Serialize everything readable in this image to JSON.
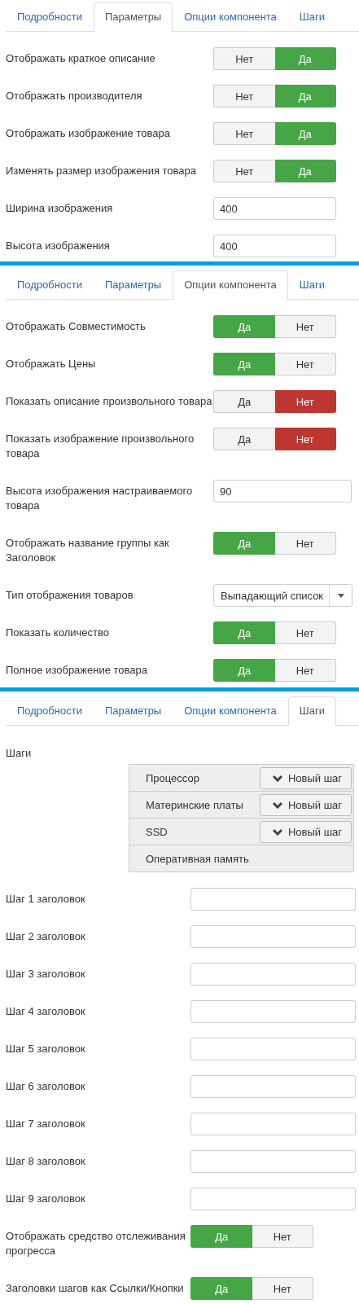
{
  "panels": [
    {
      "tabs": [
        {
          "label": "Подробности",
          "selected": false
        },
        {
          "label": "Параметры",
          "selected": true
        },
        {
          "label": "Опции компонента",
          "selected": false
        },
        {
          "label": "Шаги",
          "selected": false
        }
      ],
      "fields": [
        {
          "kind": "toggle",
          "label": "Отображать краткое описание",
          "color": "#46a546",
          "options": [
            {
              "label": "Нет",
              "selected": false
            },
            {
              "label": "Да",
              "selected": true
            }
          ]
        },
        {
          "kind": "toggle",
          "label": "Отображать производителя",
          "color": "#46a546",
          "options": [
            {
              "label": "Нет",
              "selected": false
            },
            {
              "label": "Да",
              "selected": true
            }
          ]
        },
        {
          "kind": "toggle",
          "label": "Отображать изображение товара",
          "color": "#46a546",
          "options": [
            {
              "label": "Нет",
              "selected": false
            },
            {
              "label": "Да",
              "selected": true
            }
          ]
        },
        {
          "kind": "toggle",
          "label": "Изменять размер изображения товара",
          "color": "#46a546",
          "options": [
            {
              "label": "Нет",
              "selected": false
            },
            {
              "label": "Да",
              "selected": true
            }
          ]
        },
        {
          "kind": "text",
          "label": "Ширина изображения",
          "value": "400"
        },
        {
          "kind": "text",
          "label": "Высота изображения",
          "value": "400"
        }
      ]
    },
    {
      "tabs": [
        {
          "label": "Подробности",
          "selected": false
        },
        {
          "label": "Параметры",
          "selected": false
        },
        {
          "label": "Опции компонента",
          "selected": true
        },
        {
          "label": "Шаги",
          "selected": false
        }
      ],
      "fields": [
        {
          "kind": "toggle",
          "label": "Отображать Совместимость",
          "color": "#46a546",
          "options": [
            {
              "label": "Да",
              "selected": true
            },
            {
              "label": "Нет",
              "selected": false
            }
          ]
        },
        {
          "kind": "toggle",
          "label": "Отображать Цены",
          "color": "#46a546",
          "options": [
            {
              "label": "Да",
              "selected": true
            },
            {
              "label": "Нет",
              "selected": false
            }
          ]
        },
        {
          "kind": "toggle",
          "label": "Показать описание произвольного товара",
          "color": "#bd362f",
          "options": [
            {
              "label": "Да",
              "selected": false
            },
            {
              "label": "Нет",
              "selected": true
            }
          ]
        },
        {
          "kind": "toggle",
          "label": "Показать изображение произвольного товара",
          "color": "#bd362f",
          "options": [
            {
              "label": "Да",
              "selected": false
            },
            {
              "label": "Нет",
              "selected": true
            }
          ]
        },
        {
          "kind": "text",
          "label": "Высота изображения настраиваемого товара",
          "value": "90"
        },
        {
          "kind": "toggle",
          "label": "Отображать название группы как Заголовок",
          "color": "#46a546",
          "options": [
            {
              "label": "Да",
              "selected": true
            },
            {
              "label": "Нет",
              "selected": false
            }
          ]
        },
        {
          "kind": "select",
          "label": "Тип отображения товаров",
          "value": "Выпадающий список"
        },
        {
          "kind": "toggle",
          "label": "Показать количество",
          "color": "#46a546",
          "options": [
            {
              "label": "Да",
              "selected": true
            },
            {
              "label": "Нет",
              "selected": false
            }
          ]
        },
        {
          "kind": "toggle",
          "label": "Полное изображение товара",
          "color": "#46a546",
          "options": [
            {
              "label": "Да",
              "selected": true
            },
            {
              "label": "Нет",
              "selected": false
            }
          ]
        }
      ]
    },
    {
      "tabs": [
        {
          "label": "Подробности",
          "selected": false
        },
        {
          "label": "Параметры",
          "selected": false
        },
        {
          "label": "Опции компонента",
          "selected": false
        },
        {
          "label": "Шаги",
          "selected": true
        }
      ],
      "steps": {
        "label": "Шаги",
        "items": [
          {
            "name": "Процессор",
            "button": "Новый шаг"
          },
          {
            "name": "Материнские платы",
            "button": "Новый шаг"
          },
          {
            "name": "SSD",
            "button": "Новый шаг"
          },
          {
            "name": "Оперативная память"
          }
        ]
      },
      "fields": [
        {
          "kind": "text",
          "label": "Шаг 1 заголовок"
        },
        {
          "kind": "text",
          "label": "Шаг 2 заголовок"
        },
        {
          "kind": "text",
          "label": "Шаг 3 заголовок"
        },
        {
          "kind": "text",
          "label": "Шаг 4 заголовок"
        },
        {
          "kind": "text",
          "label": "Шаг 5 заголовок"
        },
        {
          "kind": "text",
          "label": "Шаг 6 заголовок"
        },
        {
          "kind": "text",
          "label": "Шаг 7 заголовок"
        },
        {
          "kind": "text",
          "label": "Шаг 8 заголовок"
        },
        {
          "kind": "text",
          "label": "Шаг 9 заголовок"
        },
        {
          "kind": "toggle",
          "label": "Отображать средство отслеживания прогресса",
          "color": "#46a546",
          "options": [
            {
              "label": "Да",
              "selected": true
            },
            {
              "label": "Нет",
              "selected": false
            }
          ]
        },
        {
          "kind": "toggle",
          "label": "Заголовки шагов как Ссылки/Кнопки",
          "color": "#46a546",
          "options": [
            {
              "label": "Да",
              "selected": true
            },
            {
              "label": "Нет",
              "selected": false
            }
          ]
        }
      ]
    }
  ]
}
